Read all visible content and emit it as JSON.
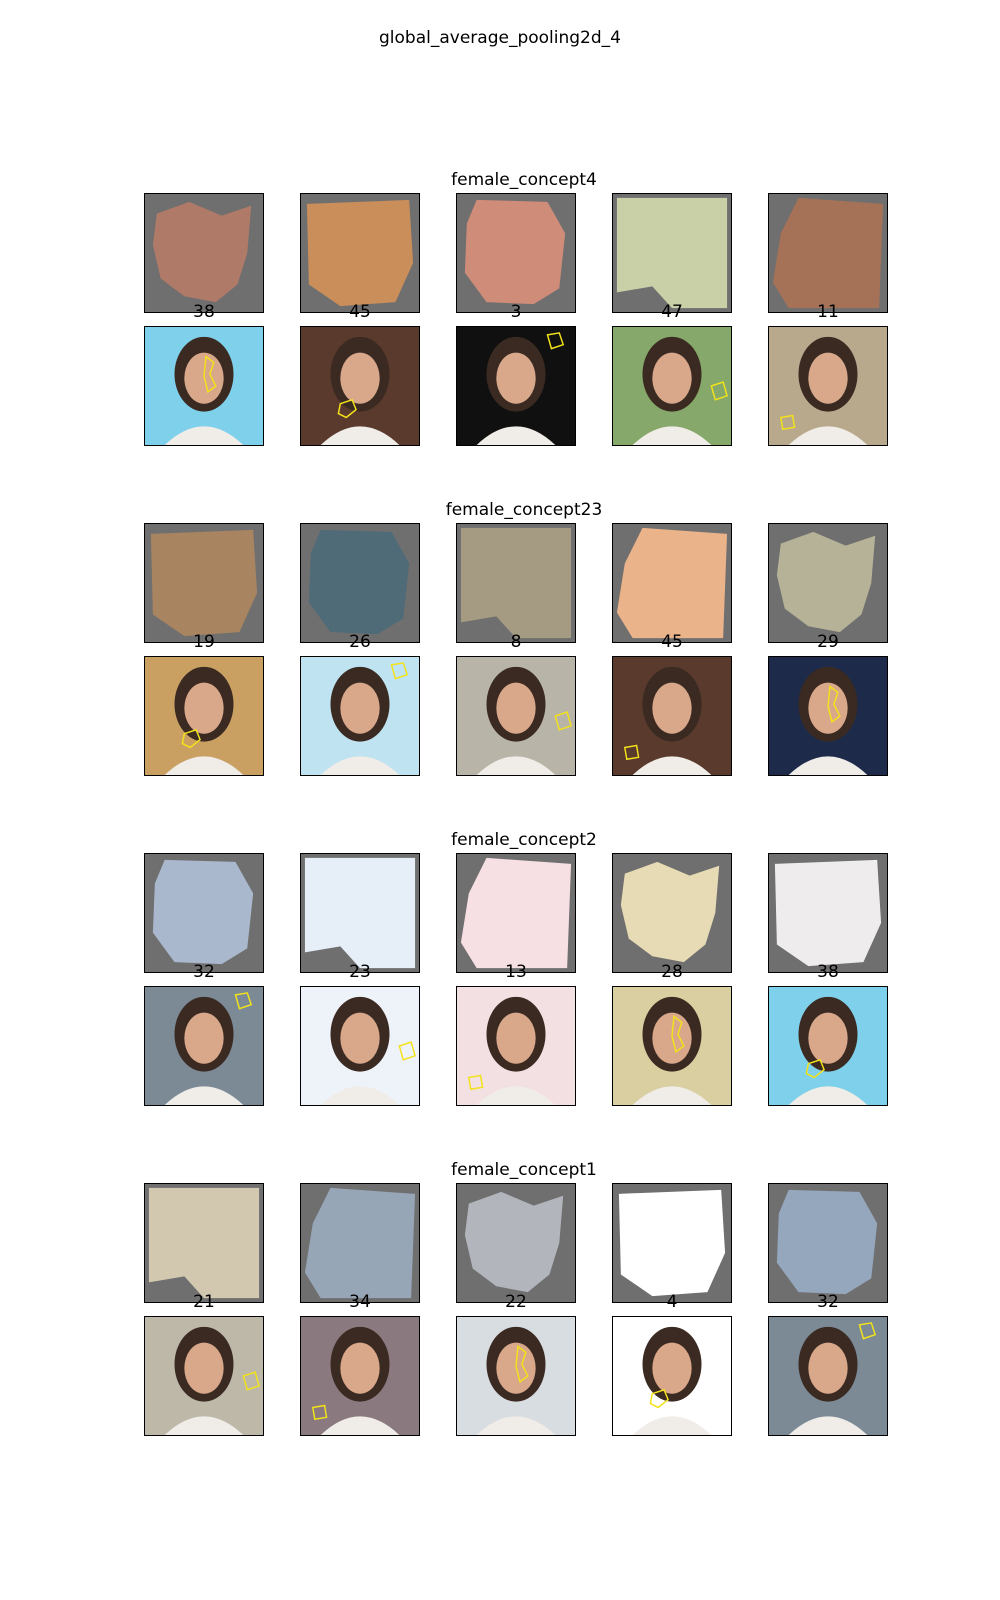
{
  "figure_title": "global_average_pooling2d_4",
  "concepts": [
    {
      "name": "female_concept4",
      "labels": [
        "38",
        "45",
        "3",
        "47",
        "11"
      ],
      "patch_colors": [
        "#b07a68",
        "#c98e5a",
        "#cf8c78",
        "#c9d0a8",
        "#a57258"
      ],
      "photo_backgrounds": [
        "#7fd0ea",
        "#5a3a2c",
        "#101010",
        "#86a86a",
        "#b8a88c"
      ]
    },
    {
      "name": "female_concept23",
      "labels": [
        "19",
        "26",
        "8",
        "45",
        "29"
      ],
      "patch_colors": [
        "#a88460",
        "#4f6b78",
        "#a59a82",
        "#eab38a",
        "#b5b298"
      ],
      "photo_backgrounds": [
        "#c9a062",
        "#bfe3f0",
        "#b8b4a8",
        "#5a3a2c",
        "#1d2a4a"
      ]
    },
    {
      "name": "female_concept2",
      "labels": [
        "32",
        "23",
        "13",
        "28",
        "38"
      ],
      "patch_colors": [
        "#a9b8cc",
        "#e6eef7",
        "#f6e0e4",
        "#e6dbb4",
        "#efecee"
      ],
      "photo_backgrounds": [
        "#7c8a96",
        "#eef3fa",
        "#f3e0e3",
        "#d9cfa0",
        "#7fd0ea"
      ]
    },
    {
      "name": "female_concept1",
      "labels": [
        "21",
        "34",
        "22",
        "4",
        "32"
      ],
      "patch_colors": [
        "#d2c8b0",
        "#97a6b7",
        "#b3b5bd",
        "#ffffff",
        "#95a7bd"
      ],
      "photo_backgrounds": [
        "#bdb8a8",
        "#8a7a80",
        "#d8dde2",
        "#ffffff",
        "#7c8a96"
      ]
    }
  ],
  "colors": {
    "patch_mask": "#6f6f6f",
    "outline": "#f2e21a",
    "border": "#000000"
  }
}
